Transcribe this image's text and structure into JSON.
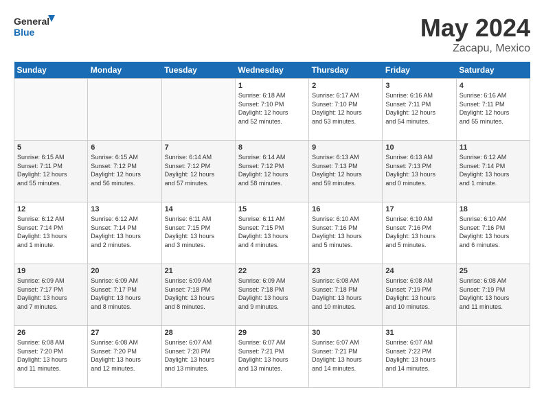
{
  "header": {
    "logo_line1": "General",
    "logo_line2": "Blue",
    "month": "May 2024",
    "location": "Zacapu, Mexico"
  },
  "days_of_week": [
    "Sunday",
    "Monday",
    "Tuesday",
    "Wednesday",
    "Thursday",
    "Friday",
    "Saturday"
  ],
  "weeks": [
    [
      {
        "day": "",
        "content": ""
      },
      {
        "day": "",
        "content": ""
      },
      {
        "day": "",
        "content": ""
      },
      {
        "day": "1",
        "content": "Sunrise: 6:18 AM\nSunset: 7:10 PM\nDaylight: 12 hours\nand 52 minutes."
      },
      {
        "day": "2",
        "content": "Sunrise: 6:17 AM\nSunset: 7:10 PM\nDaylight: 12 hours\nand 53 minutes."
      },
      {
        "day": "3",
        "content": "Sunrise: 6:16 AM\nSunset: 7:11 PM\nDaylight: 12 hours\nand 54 minutes."
      },
      {
        "day": "4",
        "content": "Sunrise: 6:16 AM\nSunset: 7:11 PM\nDaylight: 12 hours\nand 55 minutes."
      }
    ],
    [
      {
        "day": "5",
        "content": "Sunrise: 6:15 AM\nSunset: 7:11 PM\nDaylight: 12 hours\nand 55 minutes."
      },
      {
        "day": "6",
        "content": "Sunrise: 6:15 AM\nSunset: 7:12 PM\nDaylight: 12 hours\nand 56 minutes."
      },
      {
        "day": "7",
        "content": "Sunrise: 6:14 AM\nSunset: 7:12 PM\nDaylight: 12 hours\nand 57 minutes."
      },
      {
        "day": "8",
        "content": "Sunrise: 6:14 AM\nSunset: 7:12 PM\nDaylight: 12 hours\nand 58 minutes."
      },
      {
        "day": "9",
        "content": "Sunrise: 6:13 AM\nSunset: 7:13 PM\nDaylight: 12 hours\nand 59 minutes."
      },
      {
        "day": "10",
        "content": "Sunrise: 6:13 AM\nSunset: 7:13 PM\nDaylight: 13 hours\nand 0 minutes."
      },
      {
        "day": "11",
        "content": "Sunrise: 6:12 AM\nSunset: 7:14 PM\nDaylight: 13 hours\nand 1 minute."
      }
    ],
    [
      {
        "day": "12",
        "content": "Sunrise: 6:12 AM\nSunset: 7:14 PM\nDaylight: 13 hours\nand 1 minute."
      },
      {
        "day": "13",
        "content": "Sunrise: 6:12 AM\nSunset: 7:14 PM\nDaylight: 13 hours\nand 2 minutes."
      },
      {
        "day": "14",
        "content": "Sunrise: 6:11 AM\nSunset: 7:15 PM\nDaylight: 13 hours\nand 3 minutes."
      },
      {
        "day": "15",
        "content": "Sunrise: 6:11 AM\nSunset: 7:15 PM\nDaylight: 13 hours\nand 4 minutes."
      },
      {
        "day": "16",
        "content": "Sunrise: 6:10 AM\nSunset: 7:16 PM\nDaylight: 13 hours\nand 5 minutes."
      },
      {
        "day": "17",
        "content": "Sunrise: 6:10 AM\nSunset: 7:16 PM\nDaylight: 13 hours\nand 5 minutes."
      },
      {
        "day": "18",
        "content": "Sunrise: 6:10 AM\nSunset: 7:16 PM\nDaylight: 13 hours\nand 6 minutes."
      }
    ],
    [
      {
        "day": "19",
        "content": "Sunrise: 6:09 AM\nSunset: 7:17 PM\nDaylight: 13 hours\nand 7 minutes."
      },
      {
        "day": "20",
        "content": "Sunrise: 6:09 AM\nSunset: 7:17 PM\nDaylight: 13 hours\nand 8 minutes."
      },
      {
        "day": "21",
        "content": "Sunrise: 6:09 AM\nSunset: 7:18 PM\nDaylight: 13 hours\nand 8 minutes."
      },
      {
        "day": "22",
        "content": "Sunrise: 6:09 AM\nSunset: 7:18 PM\nDaylight: 13 hours\nand 9 minutes."
      },
      {
        "day": "23",
        "content": "Sunrise: 6:08 AM\nSunset: 7:18 PM\nDaylight: 13 hours\nand 10 minutes."
      },
      {
        "day": "24",
        "content": "Sunrise: 6:08 AM\nSunset: 7:19 PM\nDaylight: 13 hours\nand 10 minutes."
      },
      {
        "day": "25",
        "content": "Sunrise: 6:08 AM\nSunset: 7:19 PM\nDaylight: 13 hours\nand 11 minutes."
      }
    ],
    [
      {
        "day": "26",
        "content": "Sunrise: 6:08 AM\nSunset: 7:20 PM\nDaylight: 13 hours\nand 11 minutes."
      },
      {
        "day": "27",
        "content": "Sunrise: 6:08 AM\nSunset: 7:20 PM\nDaylight: 13 hours\nand 12 minutes."
      },
      {
        "day": "28",
        "content": "Sunrise: 6:07 AM\nSunset: 7:20 PM\nDaylight: 13 hours\nand 13 minutes."
      },
      {
        "day": "29",
        "content": "Sunrise: 6:07 AM\nSunset: 7:21 PM\nDaylight: 13 hours\nand 13 minutes."
      },
      {
        "day": "30",
        "content": "Sunrise: 6:07 AM\nSunset: 7:21 PM\nDaylight: 13 hours\nand 14 minutes."
      },
      {
        "day": "31",
        "content": "Sunrise: 6:07 AM\nSunset: 7:22 PM\nDaylight: 13 hours\nand 14 minutes."
      },
      {
        "day": "",
        "content": ""
      }
    ]
  ]
}
